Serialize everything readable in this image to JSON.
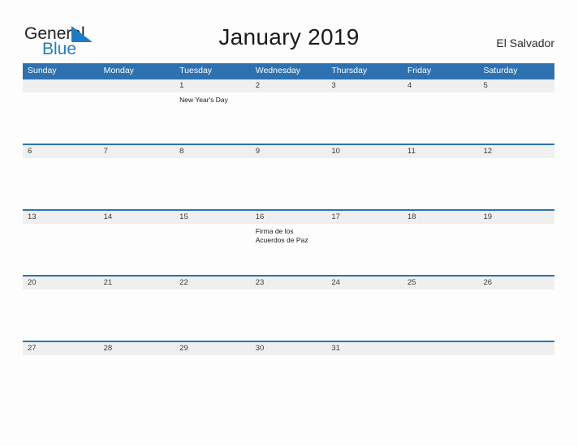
{
  "brand": {
    "word_one": "General",
    "word_two": "Blue",
    "mark": "triangle-logo-icon",
    "color_primary": "#1f7ac4",
    "color_text": "#231f20"
  },
  "header": {
    "title": "January 2019",
    "country": "El Salvador"
  },
  "theme": {
    "header_blue": "#2e71b0",
    "band_gray": "#efefef",
    "page_background": "#fdfdfd"
  },
  "calendar": {
    "day_headers": [
      "Sunday",
      "Monday",
      "Tuesday",
      "Wednesday",
      "Thursday",
      "Friday",
      "Saturday"
    ],
    "weeks": [
      {
        "days": [
          {
            "date": "",
            "events": []
          },
          {
            "date": "",
            "events": []
          },
          {
            "date": "1",
            "events": [
              "New Year's Day"
            ]
          },
          {
            "date": "2",
            "events": []
          },
          {
            "date": "3",
            "events": []
          },
          {
            "date": "4",
            "events": []
          },
          {
            "date": "5",
            "events": []
          }
        ]
      },
      {
        "days": [
          {
            "date": "6",
            "events": []
          },
          {
            "date": "7",
            "events": []
          },
          {
            "date": "8",
            "events": []
          },
          {
            "date": "9",
            "events": []
          },
          {
            "date": "10",
            "events": []
          },
          {
            "date": "11",
            "events": []
          },
          {
            "date": "12",
            "events": []
          }
        ]
      },
      {
        "days": [
          {
            "date": "13",
            "events": []
          },
          {
            "date": "14",
            "events": []
          },
          {
            "date": "15",
            "events": []
          },
          {
            "date": "16",
            "events": [
              "Firma de los",
              "Acuerdos de Paz"
            ]
          },
          {
            "date": "17",
            "events": []
          },
          {
            "date": "18",
            "events": []
          },
          {
            "date": "19",
            "events": []
          }
        ]
      },
      {
        "days": [
          {
            "date": "20",
            "events": []
          },
          {
            "date": "21",
            "events": []
          },
          {
            "date": "22",
            "events": []
          },
          {
            "date": "23",
            "events": []
          },
          {
            "date": "24",
            "events": []
          },
          {
            "date": "25",
            "events": []
          },
          {
            "date": "26",
            "events": []
          }
        ]
      },
      {
        "days": [
          {
            "date": "27",
            "events": []
          },
          {
            "date": "28",
            "events": []
          },
          {
            "date": "29",
            "events": []
          },
          {
            "date": "30",
            "events": []
          },
          {
            "date": "31",
            "events": []
          },
          {
            "date": "",
            "events": []
          },
          {
            "date": "",
            "events": []
          }
        ]
      }
    ]
  }
}
